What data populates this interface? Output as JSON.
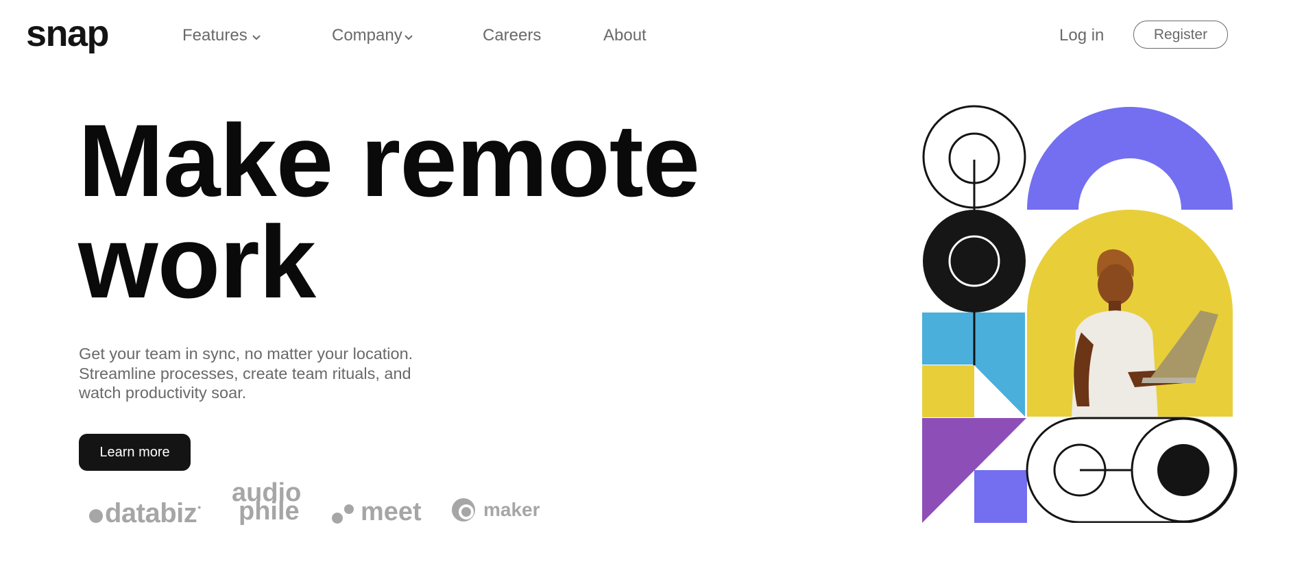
{
  "brand": {
    "logo_text": "snap"
  },
  "nav": {
    "items": [
      {
        "label": "Features",
        "has_dropdown": true
      },
      {
        "label": "Company",
        "has_dropdown": true
      },
      {
        "label": "Careers",
        "has_dropdown": false
      },
      {
        "label": "About",
        "has_dropdown": false
      }
    ],
    "login_label": "Log in",
    "register_label": "Register"
  },
  "hero": {
    "title_line1": "Make remote",
    "title_line2": "work",
    "subtitle_line1": "Get your team in sync, no matter your location.",
    "subtitle_line2": "Streamline processes, create team rituals, and",
    "subtitle_line3": "watch productivity soar.",
    "cta_label": "Learn more"
  },
  "clients": {
    "databiz": {
      "text": "databiz"
    },
    "audiophile": {
      "line1": "audio",
      "line2": "phile"
    },
    "meet": {
      "text": "meet"
    },
    "maker": {
      "text": "maker"
    }
  },
  "colors": {
    "text_dark": "#141414",
    "text_muted": "#696969",
    "logo_gray": "#a6a6a6",
    "purple": "#736ff0",
    "blue": "#4aafdb",
    "yellow": "#e8cf3a",
    "violet": "#8e4eb7"
  },
  "icons": {
    "dropdown": "chevron-down-icon",
    "illustration": "hero-illustration"
  }
}
